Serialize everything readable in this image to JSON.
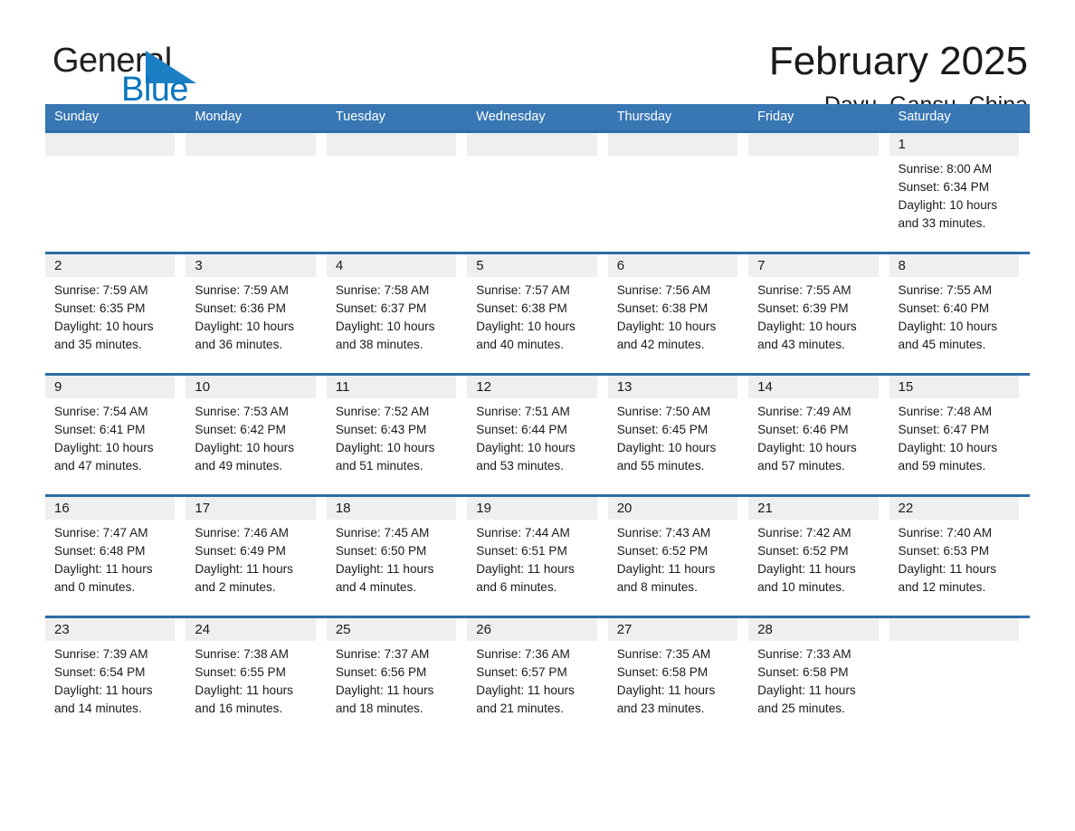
{
  "brand": {
    "name_part1": "General",
    "name_part2": "Blue",
    "accent_color": "#0b76bf",
    "triangle_color": "#1b7fc4"
  },
  "header": {
    "month_title": "February 2025",
    "location": "Dayu, Gansu, China"
  },
  "theme": {
    "header_blue": "#3876b4",
    "row_border_blue": "#2e6da9",
    "day_band_gray": "#efefef"
  },
  "weekdays": [
    "Sunday",
    "Monday",
    "Tuesday",
    "Wednesday",
    "Thursday",
    "Friday",
    "Saturday"
  ],
  "weeks": [
    [
      {
        "day": "",
        "sunrise": "",
        "sunset": "",
        "daylight_line1": "",
        "daylight_line2": ""
      },
      {
        "day": "",
        "sunrise": "",
        "sunset": "",
        "daylight_line1": "",
        "daylight_line2": ""
      },
      {
        "day": "",
        "sunrise": "",
        "sunset": "",
        "daylight_line1": "",
        "daylight_line2": ""
      },
      {
        "day": "",
        "sunrise": "",
        "sunset": "",
        "daylight_line1": "",
        "daylight_line2": ""
      },
      {
        "day": "",
        "sunrise": "",
        "sunset": "",
        "daylight_line1": "",
        "daylight_line2": ""
      },
      {
        "day": "",
        "sunrise": "",
        "sunset": "",
        "daylight_line1": "",
        "daylight_line2": ""
      },
      {
        "day": "1",
        "sunrise": "Sunrise: 8:00 AM",
        "sunset": "Sunset: 6:34 PM",
        "daylight_line1": "Daylight: 10 hours",
        "daylight_line2": "and 33 minutes."
      }
    ],
    [
      {
        "day": "2",
        "sunrise": "Sunrise: 7:59 AM",
        "sunset": "Sunset: 6:35 PM",
        "daylight_line1": "Daylight: 10 hours",
        "daylight_line2": "and 35 minutes."
      },
      {
        "day": "3",
        "sunrise": "Sunrise: 7:59 AM",
        "sunset": "Sunset: 6:36 PM",
        "daylight_line1": "Daylight: 10 hours",
        "daylight_line2": "and 36 minutes."
      },
      {
        "day": "4",
        "sunrise": "Sunrise: 7:58 AM",
        "sunset": "Sunset: 6:37 PM",
        "daylight_line1": "Daylight: 10 hours",
        "daylight_line2": "and 38 minutes."
      },
      {
        "day": "5",
        "sunrise": "Sunrise: 7:57 AM",
        "sunset": "Sunset: 6:38 PM",
        "daylight_line1": "Daylight: 10 hours",
        "daylight_line2": "and 40 minutes."
      },
      {
        "day": "6",
        "sunrise": "Sunrise: 7:56 AM",
        "sunset": "Sunset: 6:38 PM",
        "daylight_line1": "Daylight: 10 hours",
        "daylight_line2": "and 42 minutes."
      },
      {
        "day": "7",
        "sunrise": "Sunrise: 7:55 AM",
        "sunset": "Sunset: 6:39 PM",
        "daylight_line1": "Daylight: 10 hours",
        "daylight_line2": "and 43 minutes."
      },
      {
        "day": "8",
        "sunrise": "Sunrise: 7:55 AM",
        "sunset": "Sunset: 6:40 PM",
        "daylight_line1": "Daylight: 10 hours",
        "daylight_line2": "and 45 minutes."
      }
    ],
    [
      {
        "day": "9",
        "sunrise": "Sunrise: 7:54 AM",
        "sunset": "Sunset: 6:41 PM",
        "daylight_line1": "Daylight: 10 hours",
        "daylight_line2": "and 47 minutes."
      },
      {
        "day": "10",
        "sunrise": "Sunrise: 7:53 AM",
        "sunset": "Sunset: 6:42 PM",
        "daylight_line1": "Daylight: 10 hours",
        "daylight_line2": "and 49 minutes."
      },
      {
        "day": "11",
        "sunrise": "Sunrise: 7:52 AM",
        "sunset": "Sunset: 6:43 PM",
        "daylight_line1": "Daylight: 10 hours",
        "daylight_line2": "and 51 minutes."
      },
      {
        "day": "12",
        "sunrise": "Sunrise: 7:51 AM",
        "sunset": "Sunset: 6:44 PM",
        "daylight_line1": "Daylight: 10 hours",
        "daylight_line2": "and 53 minutes."
      },
      {
        "day": "13",
        "sunrise": "Sunrise: 7:50 AM",
        "sunset": "Sunset: 6:45 PM",
        "daylight_line1": "Daylight: 10 hours",
        "daylight_line2": "and 55 minutes."
      },
      {
        "day": "14",
        "sunrise": "Sunrise: 7:49 AM",
        "sunset": "Sunset: 6:46 PM",
        "daylight_line1": "Daylight: 10 hours",
        "daylight_line2": "and 57 minutes."
      },
      {
        "day": "15",
        "sunrise": "Sunrise: 7:48 AM",
        "sunset": "Sunset: 6:47 PM",
        "daylight_line1": "Daylight: 10 hours",
        "daylight_line2": "and 59 minutes."
      }
    ],
    [
      {
        "day": "16",
        "sunrise": "Sunrise: 7:47 AM",
        "sunset": "Sunset: 6:48 PM",
        "daylight_line1": "Daylight: 11 hours",
        "daylight_line2": "and 0 minutes."
      },
      {
        "day": "17",
        "sunrise": "Sunrise: 7:46 AM",
        "sunset": "Sunset: 6:49 PM",
        "daylight_line1": "Daylight: 11 hours",
        "daylight_line2": "and 2 minutes."
      },
      {
        "day": "18",
        "sunrise": "Sunrise: 7:45 AM",
        "sunset": "Sunset: 6:50 PM",
        "daylight_line1": "Daylight: 11 hours",
        "daylight_line2": "and 4 minutes."
      },
      {
        "day": "19",
        "sunrise": "Sunrise: 7:44 AM",
        "sunset": "Sunset: 6:51 PM",
        "daylight_line1": "Daylight: 11 hours",
        "daylight_line2": "and 6 minutes."
      },
      {
        "day": "20",
        "sunrise": "Sunrise: 7:43 AM",
        "sunset": "Sunset: 6:52 PM",
        "daylight_line1": "Daylight: 11 hours",
        "daylight_line2": "and 8 minutes."
      },
      {
        "day": "21",
        "sunrise": "Sunrise: 7:42 AM",
        "sunset": "Sunset: 6:52 PM",
        "daylight_line1": "Daylight: 11 hours",
        "daylight_line2": "and 10 minutes."
      },
      {
        "day": "22",
        "sunrise": "Sunrise: 7:40 AM",
        "sunset": "Sunset: 6:53 PM",
        "daylight_line1": "Daylight: 11 hours",
        "daylight_line2": "and 12 minutes."
      }
    ],
    [
      {
        "day": "23",
        "sunrise": "Sunrise: 7:39 AM",
        "sunset": "Sunset: 6:54 PM",
        "daylight_line1": "Daylight: 11 hours",
        "daylight_line2": "and 14 minutes."
      },
      {
        "day": "24",
        "sunrise": "Sunrise: 7:38 AM",
        "sunset": "Sunset: 6:55 PM",
        "daylight_line1": "Daylight: 11 hours",
        "daylight_line2": "and 16 minutes."
      },
      {
        "day": "25",
        "sunrise": "Sunrise: 7:37 AM",
        "sunset": "Sunset: 6:56 PM",
        "daylight_line1": "Daylight: 11 hours",
        "daylight_line2": "and 18 minutes."
      },
      {
        "day": "26",
        "sunrise": "Sunrise: 7:36 AM",
        "sunset": "Sunset: 6:57 PM",
        "daylight_line1": "Daylight: 11 hours",
        "daylight_line2": "and 21 minutes."
      },
      {
        "day": "27",
        "sunrise": "Sunrise: 7:35 AM",
        "sunset": "Sunset: 6:58 PM",
        "daylight_line1": "Daylight: 11 hours",
        "daylight_line2": "and 23 minutes."
      },
      {
        "day": "28",
        "sunrise": "Sunrise: 7:33 AM",
        "sunset": "Sunset: 6:58 PM",
        "daylight_line1": "Daylight: 11 hours",
        "daylight_line2": "and 25 minutes."
      },
      {
        "day": "",
        "sunrise": "",
        "sunset": "",
        "daylight_line1": "",
        "daylight_line2": ""
      }
    ]
  ]
}
